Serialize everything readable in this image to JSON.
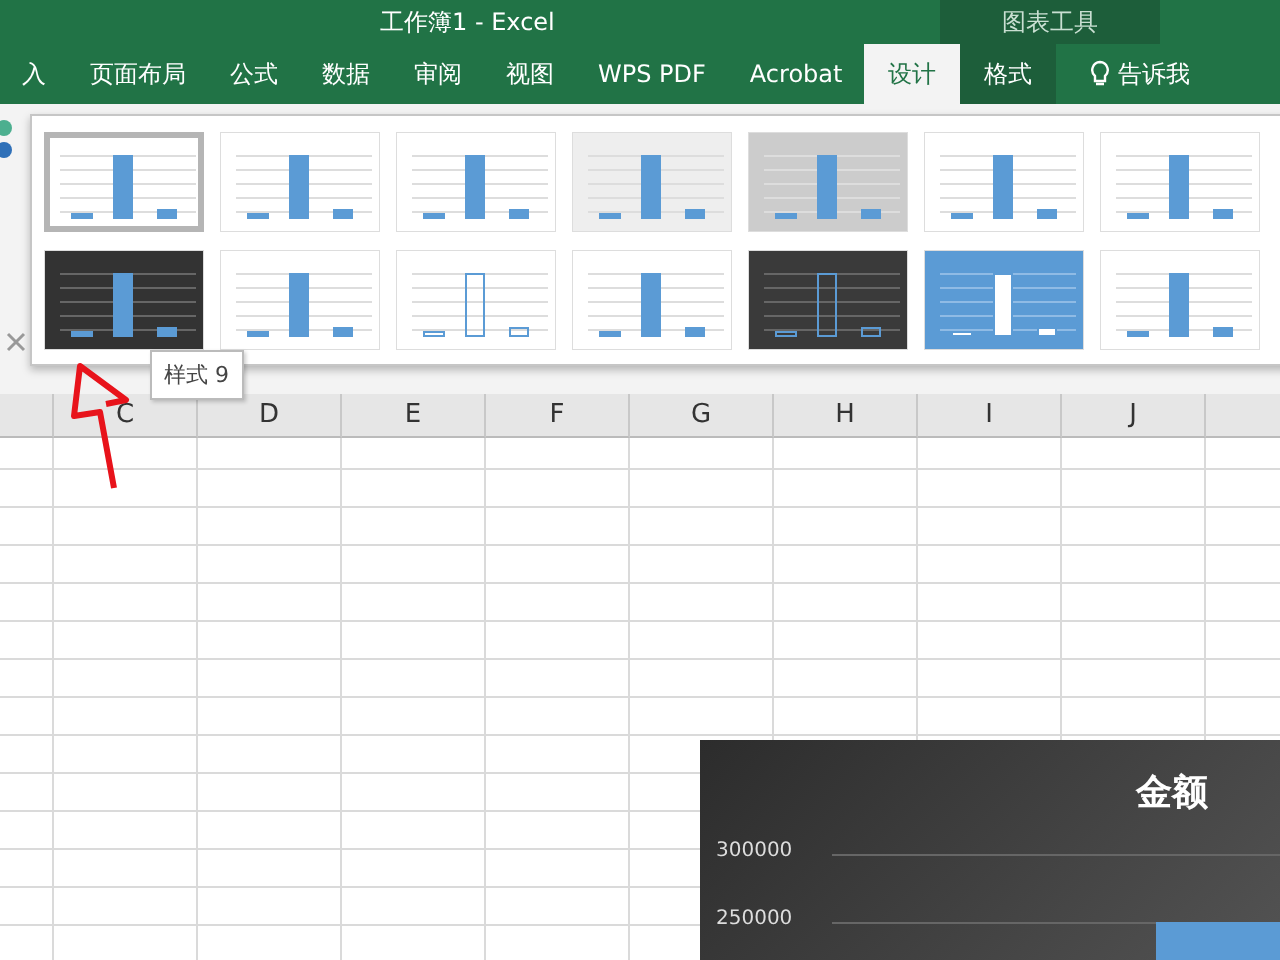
{
  "window": {
    "title": "工作簿1 - Excel",
    "context_title": "图表工具"
  },
  "tabs": [
    {
      "label": "入",
      "kind": "main",
      "selected": false
    },
    {
      "label": "页面布局",
      "kind": "main",
      "selected": false
    },
    {
      "label": "公式",
      "kind": "main",
      "selected": false
    },
    {
      "label": "数据",
      "kind": "main",
      "selected": false
    },
    {
      "label": "审阅",
      "kind": "main",
      "selected": false
    },
    {
      "label": "视图",
      "kind": "main",
      "selected": false
    },
    {
      "label": "WPS PDF",
      "kind": "main",
      "selected": false
    },
    {
      "label": "Acrobat",
      "kind": "main",
      "selected": false
    },
    {
      "label": "设计",
      "kind": "context",
      "selected": true
    },
    {
      "label": "格式",
      "kind": "context",
      "selected": false
    },
    {
      "label": "告诉我",
      "kind": "tell",
      "selected": false
    }
  ],
  "gallery": [
    {
      "kind": "light",
      "selected": true
    },
    {
      "kind": "lines",
      "selected": false
    },
    {
      "kind": "striped",
      "selected": false
    },
    {
      "kind": "gradient",
      "selected": false
    },
    {
      "kind": "gray",
      "selected": false
    },
    {
      "kind": "light",
      "selected": false
    },
    {
      "kind": "light",
      "selected": false
    },
    {
      "kind": "dark",
      "selected": false
    },
    {
      "kind": "light",
      "selected": false
    },
    {
      "kind": "outline",
      "selected": false
    },
    {
      "kind": "light",
      "selected": false
    },
    {
      "kind": "darkoutline",
      "selected": false
    },
    {
      "kind": "blue",
      "selected": false
    },
    {
      "kind": "light",
      "selected": false
    }
  ],
  "tooltip": "样式 9",
  "columns": [
    "C",
    "D",
    "E",
    "F",
    "G",
    "H",
    "I",
    "J"
  ],
  "chart": {
    "title": "金额",
    "y_labels": [
      "300000",
      "250000"
    ]
  }
}
